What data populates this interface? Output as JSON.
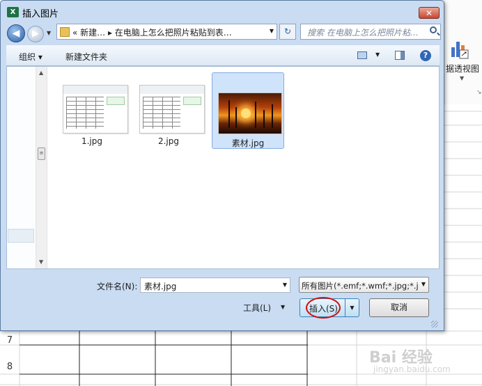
{
  "dialog": {
    "title": "插入图片",
    "app_icon_text": "X",
    "close_glyph": "✕",
    "back_glyph": "◀",
    "forward_glyph": "▶",
    "address": "« 新建… ▸ 在电脑上怎么把照片粘贴到表…",
    "refresh_glyph": "↻",
    "search_placeholder": "搜索 在电脑上怎么把照片粘…",
    "toolbar": {
      "organize": "组织 ▾",
      "new_folder": "新建文件夹",
      "help": "?"
    },
    "files": [
      {
        "name": "1.jpg",
        "kind": "spreadsheet",
        "selected": false
      },
      {
        "name": "2.jpg",
        "kind": "spreadsheet",
        "selected": false
      },
      {
        "name": "素材.jpg",
        "kind": "photo",
        "selected": true
      }
    ],
    "filename_label": "文件名(N):",
    "filename_value": "素材.jpg",
    "file_type": "所有图片(*.emf;*.wmf;*.jpg;*.jp",
    "tools_label": "工具(L)",
    "insert_label": "插入(S)",
    "cancel_label": "取消",
    "dropdown_glyph": "▼",
    "scroll_up_glyph": "▲",
    "scroll_down_glyph": "▼",
    "thumb_glyph": "≡"
  },
  "excel": {
    "ribbon_label": "据透视图",
    "ribbon_drop": "▼",
    "corner_glyph": "↘",
    "row_numbers": [
      "7",
      "8"
    ]
  },
  "watermark": {
    "text": "Bai 经验",
    "sub": "jingyan.baidu.com"
  },
  "colors": {
    "accent": "#3c7fb1",
    "selection": "#cfe3fb",
    "highlight_ring": "#d11212",
    "excel_green": "#1f7244"
  }
}
